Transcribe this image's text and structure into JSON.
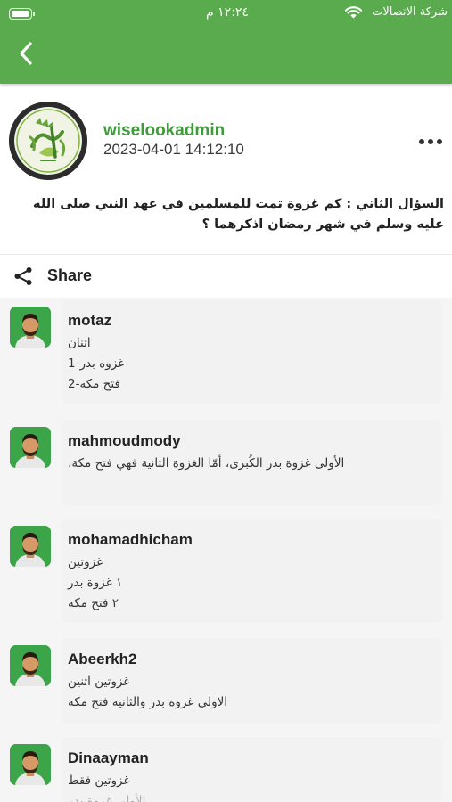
{
  "status_bar": {
    "carrier": "شركة الاتصالات",
    "time": "١٢:٢٤ م"
  },
  "colors": {
    "header_bg": "#5aaa4e",
    "author_name": "#3f9b3a",
    "avatar_bg": "#3ca54a"
  },
  "header": {
    "back_icon": "chevron-left-icon"
  },
  "post": {
    "author": "wiselookadmin",
    "date": "2023-04-01 14:12:10",
    "more_icon": "more-horizontal-icon",
    "question": "السؤال الثاني : كم غزوة تمت للمسلمين في عهد النبي صلى الله عليه وسلم في شهر رمضان اذكرهما ؟"
  },
  "share": {
    "icon": "share-icon",
    "label": "Share"
  },
  "comments": [
    {
      "username": "motaz",
      "lines": [
        "اثنان",
        "غزوه بدر-1",
        "فتح مكه-2"
      ]
    },
    {
      "username": "mahmoudmody",
      "lines": [
        "الأولى غزوة بدر الكُبرى، أمّا الغزوة الثانية  فهي فتح مكة،"
      ]
    },
    {
      "username": "mohamadhicham",
      "lines": [
        "غزوتين",
        "١ غزوة بدر",
        "٢ فتح مكة"
      ]
    },
    {
      "username": "Abeerkh2",
      "lines": [
        "غزوتين اثنين",
        "الاولى غزوة بدر والثانية فتح مكة"
      ]
    },
    {
      "username": "Dinaayman",
      "lines": [
        "غزوتين فقط",
        "الأولى غزوة بدر"
      ]
    }
  ]
}
